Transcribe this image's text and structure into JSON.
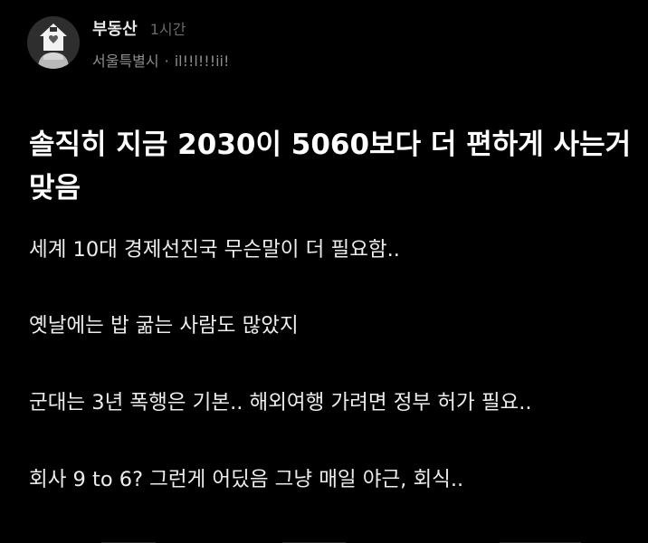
{
  "post": {
    "author": "부동산",
    "time": "1시간",
    "location": "서울특별시",
    "separator": "·",
    "nickname": "il!!l!!!ii!",
    "title": "솔직히 지금 2030이 5060보다 더 편하게 사는거 맞음",
    "lines": [
      "세계 10대 경제선진국 무슨말이 더 필요함..",
      "옛날에는 밥 굶는 사람도 많았지",
      "군대는 3년 폭행은 기본..  해외여행 가려면 정부 허가 필요..",
      "회사 9 to 6? 그런게 어딨음 그냥 매일 야근, 회식.."
    ]
  },
  "avatar_icon": "house-heart-icon",
  "colors": {
    "background": "#000000",
    "text": "#ffffff",
    "muted": "#8d8d8d"
  }
}
